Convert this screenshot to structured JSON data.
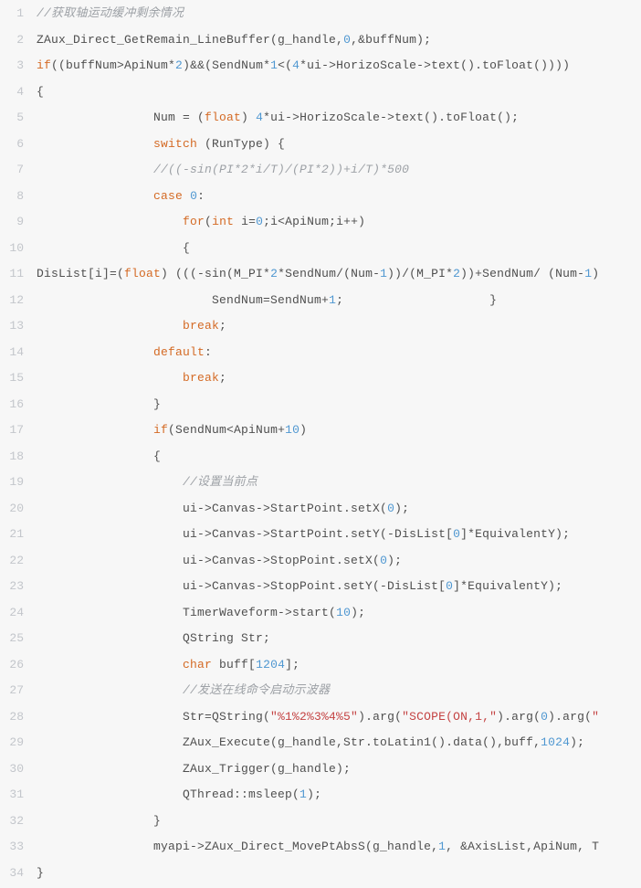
{
  "code": {
    "lines": [
      {
        "n": "1",
        "seg": [
          {
            "c": "cmt",
            "t": "//获取轴运动缓冲剩余情况"
          }
        ]
      },
      {
        "n": "2",
        "seg": [
          {
            "t": "ZAux_Direct_GetRemain_LineBuffer(g_handle,"
          },
          {
            "c": "num",
            "t": "0"
          },
          {
            "t": ",&buffNum);"
          }
        ]
      },
      {
        "n": "3",
        "seg": [
          {
            "c": "kw",
            "t": "if"
          },
          {
            "t": "((buffNum>ApiNum*"
          },
          {
            "c": "num",
            "t": "2"
          },
          {
            "t": ")&&(SendNum*"
          },
          {
            "c": "num",
            "t": "1"
          },
          {
            "t": "<("
          },
          {
            "c": "num",
            "t": "4"
          },
          {
            "t": "*ui->HorizoScale->text().toFloat())))"
          }
        ]
      },
      {
        "n": "4",
        "seg": [
          {
            "t": "{"
          }
        ]
      },
      {
        "n": "5",
        "seg": [
          {
            "t": "                Num = ("
          },
          {
            "c": "kw",
            "t": "float"
          },
          {
            "t": ") "
          },
          {
            "c": "num",
            "t": "4"
          },
          {
            "t": "*ui->HorizoScale->text().toFloat();"
          }
        ]
      },
      {
        "n": "6",
        "seg": [
          {
            "t": "                "
          },
          {
            "c": "kw",
            "t": "switch"
          },
          {
            "t": " (RunType) {"
          }
        ]
      },
      {
        "n": "7",
        "seg": [
          {
            "t": "                "
          },
          {
            "c": "cmt",
            "t": "//((-sin(PI*2*i/T)/(PI*2))+i/T)*500"
          }
        ]
      },
      {
        "n": "8",
        "seg": [
          {
            "t": "                "
          },
          {
            "c": "kw",
            "t": "case"
          },
          {
            "t": " "
          },
          {
            "c": "num",
            "t": "0"
          },
          {
            "t": ":"
          }
        ]
      },
      {
        "n": "9",
        "seg": [
          {
            "t": "                    "
          },
          {
            "c": "kw",
            "t": "for"
          },
          {
            "t": "("
          },
          {
            "c": "kw",
            "t": "int"
          },
          {
            "t": " i="
          },
          {
            "c": "num",
            "t": "0"
          },
          {
            "t": ";i<ApiNum;i++)"
          }
        ]
      },
      {
        "n": "10",
        "seg": [
          {
            "t": "                    {"
          }
        ]
      },
      {
        "n": "11",
        "seg": [
          {
            "c": "fn",
            "t": "DisList[i]=("
          },
          {
            "c": "kw",
            "t": "float"
          },
          {
            "t": ") (((-sin(M_PI*"
          },
          {
            "c": "num",
            "t": "2"
          },
          {
            "t": "*SendNum/(Num-"
          },
          {
            "c": "num",
            "t": "1"
          },
          {
            "t": "))/(M_PI*"
          },
          {
            "c": "num",
            "t": "2"
          },
          {
            "t": "))+SendNum/ (Num-"
          },
          {
            "c": "num",
            "t": "1"
          },
          {
            "t": ")"
          }
        ]
      },
      {
        "n": "12",
        "seg": [
          {
            "t": "                        SendNum=SendNum+"
          },
          {
            "c": "num",
            "t": "1"
          },
          {
            "t": ";                    }"
          }
        ]
      },
      {
        "n": "13",
        "seg": [
          {
            "t": "                    "
          },
          {
            "c": "kw",
            "t": "break"
          },
          {
            "t": ";"
          }
        ]
      },
      {
        "n": "14",
        "seg": [
          {
            "t": "                "
          },
          {
            "c": "kw",
            "t": "default"
          },
          {
            "t": ":"
          }
        ]
      },
      {
        "n": "15",
        "seg": [
          {
            "t": "                    "
          },
          {
            "c": "kw",
            "t": "break"
          },
          {
            "t": ";"
          }
        ]
      },
      {
        "n": "16",
        "seg": [
          {
            "t": "                }"
          }
        ]
      },
      {
        "n": "17",
        "seg": [
          {
            "t": "                "
          },
          {
            "c": "kw",
            "t": "if"
          },
          {
            "t": "(SendNum<ApiNum+"
          },
          {
            "c": "num",
            "t": "10"
          },
          {
            "t": ")"
          }
        ]
      },
      {
        "n": "18",
        "seg": [
          {
            "t": "                {"
          }
        ]
      },
      {
        "n": "19",
        "seg": [
          {
            "t": "                    "
          },
          {
            "c": "cmt",
            "t": "//设置当前点"
          }
        ]
      },
      {
        "n": "20",
        "seg": [
          {
            "t": "                    ui->Canvas->StartPoint.setX("
          },
          {
            "c": "num",
            "t": "0"
          },
          {
            "t": ");"
          }
        ]
      },
      {
        "n": "21",
        "seg": [
          {
            "t": "                    ui->Canvas->StartPoint.setY(-DisList["
          },
          {
            "c": "num",
            "t": "0"
          },
          {
            "t": "]*EquivalentY);"
          }
        ]
      },
      {
        "n": "22",
        "seg": [
          {
            "t": "                    ui->Canvas->StopPoint.setX("
          },
          {
            "c": "num",
            "t": "0"
          },
          {
            "t": ");"
          }
        ]
      },
      {
        "n": "23",
        "seg": [
          {
            "t": "                    ui->Canvas->StopPoint.setY(-DisList["
          },
          {
            "c": "num",
            "t": "0"
          },
          {
            "t": "]*EquivalentY);"
          }
        ]
      },
      {
        "n": "24",
        "seg": [
          {
            "t": "                    TimerWaveform->start("
          },
          {
            "c": "num",
            "t": "10"
          },
          {
            "t": ");"
          }
        ]
      },
      {
        "n": "25",
        "seg": [
          {
            "t": "                    QString Str;"
          }
        ]
      },
      {
        "n": "26",
        "seg": [
          {
            "t": "                    "
          },
          {
            "c": "kw",
            "t": "char"
          },
          {
            "t": " buff["
          },
          {
            "c": "num",
            "t": "1204"
          },
          {
            "t": "];"
          }
        ]
      },
      {
        "n": "27",
        "seg": [
          {
            "t": "                    "
          },
          {
            "c": "cmt",
            "t": "//发送在线命令启动示波器"
          }
        ]
      },
      {
        "n": "28",
        "seg": [
          {
            "t": "                    Str=QString("
          },
          {
            "c": "str",
            "t": "\"%1%2%3%4%5\""
          },
          {
            "t": ").arg("
          },
          {
            "c": "str",
            "t": "\"SCOPE(ON,1,\""
          },
          {
            "t": ").arg("
          },
          {
            "c": "num",
            "t": "0"
          },
          {
            "t": ").arg("
          },
          {
            "c": "str",
            "t": "\""
          }
        ]
      },
      {
        "n": "29",
        "seg": [
          {
            "t": "                    ZAux_Execute(g_handle,Str.toLatin1().data(),buff,"
          },
          {
            "c": "num",
            "t": "1024"
          },
          {
            "t": ");"
          }
        ]
      },
      {
        "n": "30",
        "seg": [
          {
            "t": "                    ZAux_Trigger(g_handle);"
          }
        ]
      },
      {
        "n": "31",
        "seg": [
          {
            "t": "                    QThread::msleep("
          },
          {
            "c": "num",
            "t": "1"
          },
          {
            "t": ");"
          }
        ]
      },
      {
        "n": "32",
        "seg": [
          {
            "t": "                }"
          }
        ]
      },
      {
        "n": "33",
        "seg": [
          {
            "t": "                myapi->ZAux_Direct_MovePtAbsS(g_handle,"
          },
          {
            "c": "num",
            "t": "1"
          },
          {
            "t": ", &AxisList,ApiNum, T"
          }
        ]
      },
      {
        "n": "34",
        "seg": [
          {
            "t": "}"
          }
        ]
      }
    ]
  }
}
